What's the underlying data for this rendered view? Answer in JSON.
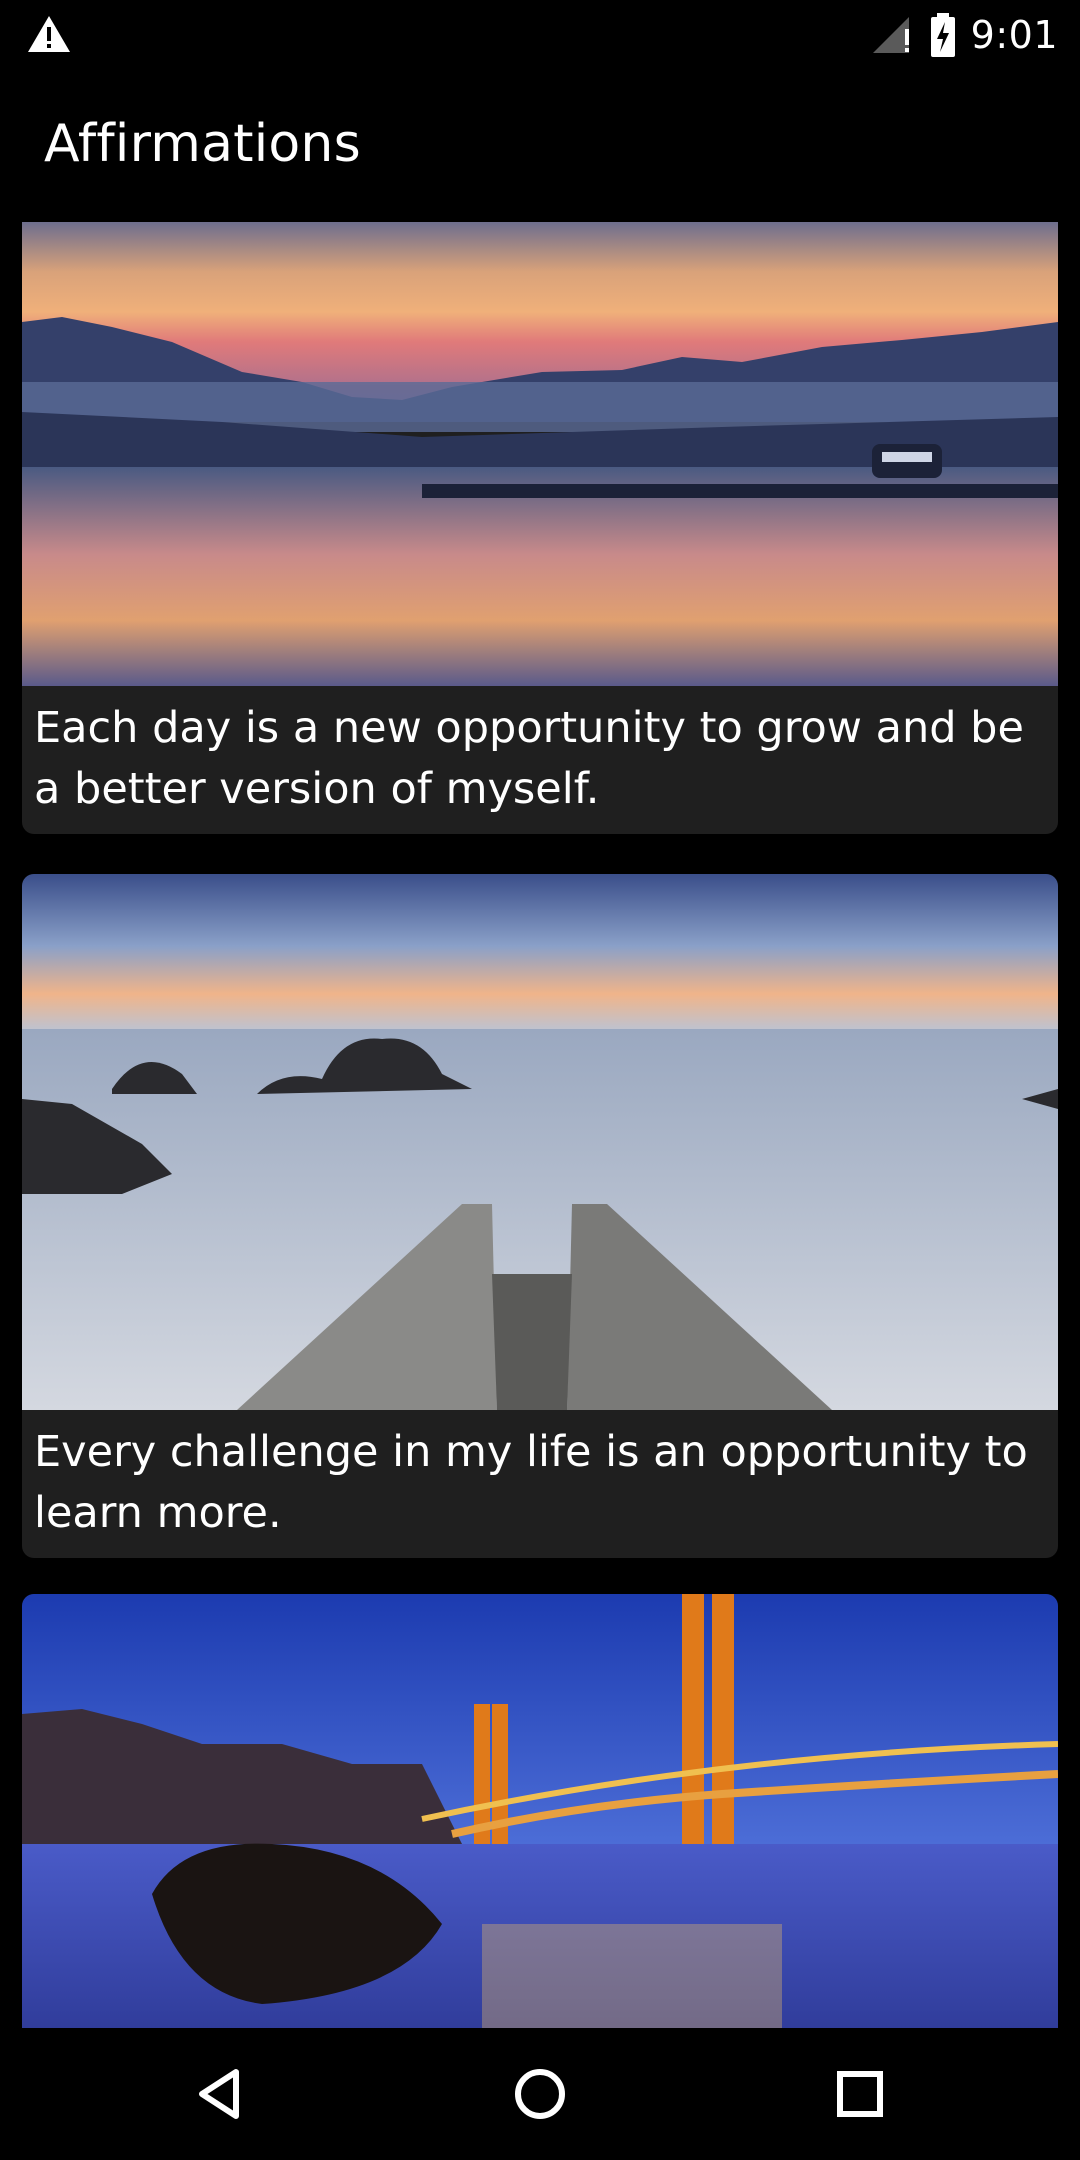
{
  "status_bar": {
    "time": "9:01",
    "icons": [
      "warning-icon",
      "signal-icon",
      "battery-charging-icon"
    ]
  },
  "app_bar": {
    "title": "Affirmations"
  },
  "cards": [
    {
      "image_icon": "lake-sunset-image",
      "text": "Each day is a new opportunity to grow and be a better version of myself."
    },
    {
      "image_icon": "pier-sea-sunset-image",
      "text": "Every challenge in my life is an opportunity to learn more."
    },
    {
      "image_icon": "golden-gate-bridge-image",
      "text": ""
    }
  ],
  "nav_bar": {
    "icons": [
      "back-icon",
      "home-icon",
      "recents-icon"
    ]
  },
  "colors": {
    "background": "#000000",
    "card": "#1f1f1f",
    "text": "#ffffff"
  }
}
